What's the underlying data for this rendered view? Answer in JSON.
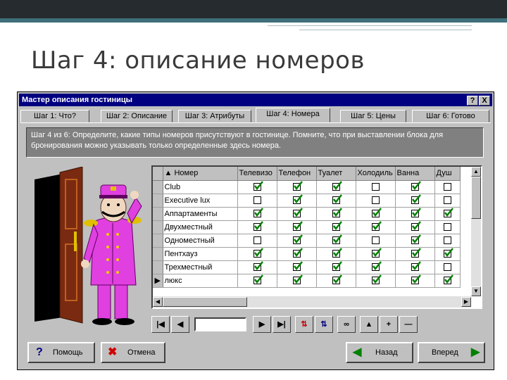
{
  "slide": {
    "title": "Шаг 4: описание номеров"
  },
  "dialog": {
    "title": "Мастер описания гостиницы",
    "help_btn": "?",
    "close_btn": "X",
    "tabs": [
      "Шаг 1: Что?",
      "Шаг 2: Описание",
      "Шаг 3: Атрибуты",
      "Шаг 4: Номера",
      "Шаг 5: Цены",
      "Шаг 6: Готово"
    ],
    "active_tab": 3,
    "info_text": "Шаг 4 из 6: Определите, какие типы номеров присутствуют в гостинице. Помните, что при выставлении блока для бронирования можно указывать только определенные здесь номера.",
    "grid": {
      "columns": [
        "Номер",
        "Телевизо",
        "Телефон",
        "Туалет",
        "Холодиль",
        "Ванна",
        "Душ"
      ],
      "rows": [
        {
          "name": "Club",
          "checks": [
            true,
            true,
            true,
            false,
            true,
            false
          ]
        },
        {
          "name": "Executive lux",
          "checks": [
            false,
            true,
            true,
            false,
            true,
            false
          ]
        },
        {
          "name": "Аппартаменты",
          "checks": [
            true,
            true,
            true,
            true,
            true,
            true
          ]
        },
        {
          "name": "Двухместный",
          "checks": [
            true,
            true,
            true,
            true,
            true,
            false
          ]
        },
        {
          "name": "Одноместный",
          "checks": [
            false,
            true,
            true,
            false,
            true,
            false
          ]
        },
        {
          "name": "Пентхауз",
          "checks": [
            true,
            true,
            true,
            true,
            true,
            true
          ]
        },
        {
          "name": "Трехместный",
          "checks": [
            true,
            true,
            true,
            true,
            true,
            false
          ]
        },
        {
          "name": "люкс",
          "checks": [
            true,
            true,
            true,
            true,
            true,
            true
          ]
        }
      ],
      "current_row": 7
    },
    "buttons": {
      "help": "Помощь",
      "cancel": "Отмена",
      "back": "Назад",
      "next": "Вперед"
    },
    "icons": {
      "help": "question-icon",
      "cancel": "red-x-icon",
      "back": "green-arrow-left-icon",
      "next": "green-arrow-right-icon"
    },
    "colors": {
      "titlebar": "#000080",
      "check": "#008000",
      "figure": "#e040e0"
    }
  }
}
